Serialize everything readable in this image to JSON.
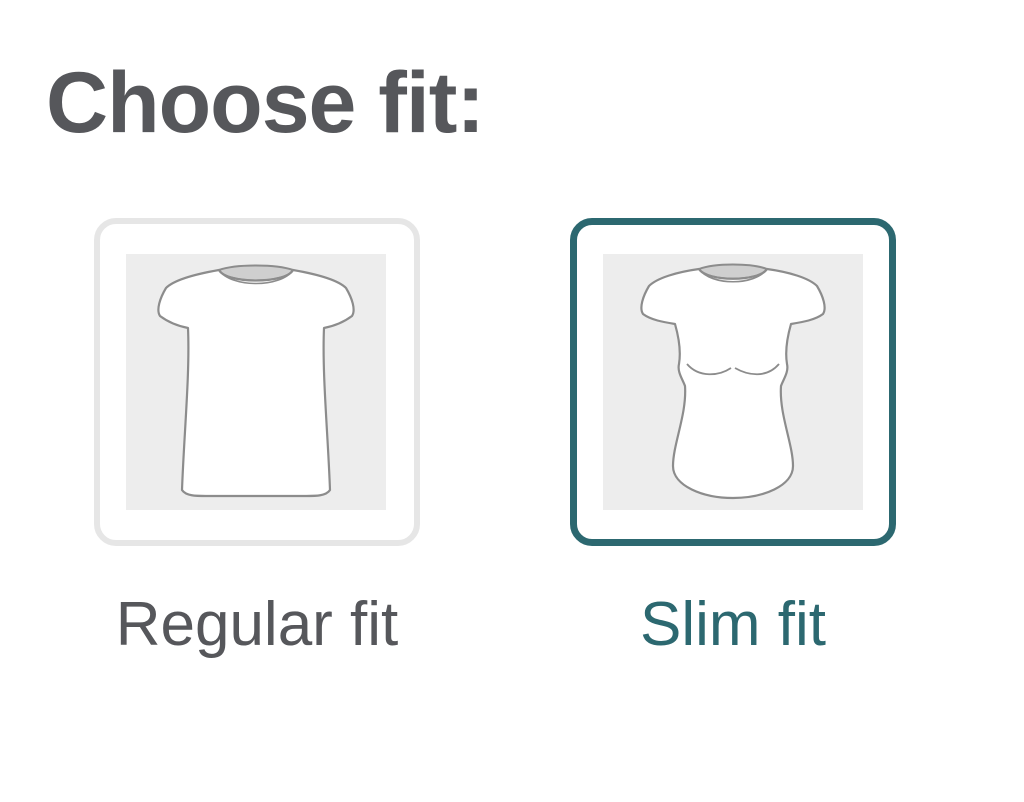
{
  "page": {
    "title": "Choose fit:"
  },
  "options": [
    {
      "id": "regular",
      "label": "Regular fit",
      "icon": "regular-fit-tshirt-icon",
      "selected": false
    },
    {
      "id": "slim",
      "label": "Slim fit",
      "icon": "slim-fit-tshirt-icon",
      "selected": true
    }
  ],
  "colors": {
    "text": "#56575b",
    "accent": "#2c6870",
    "unselected_border": "#e6e6e6",
    "illustration_bg": "#ededed"
  }
}
